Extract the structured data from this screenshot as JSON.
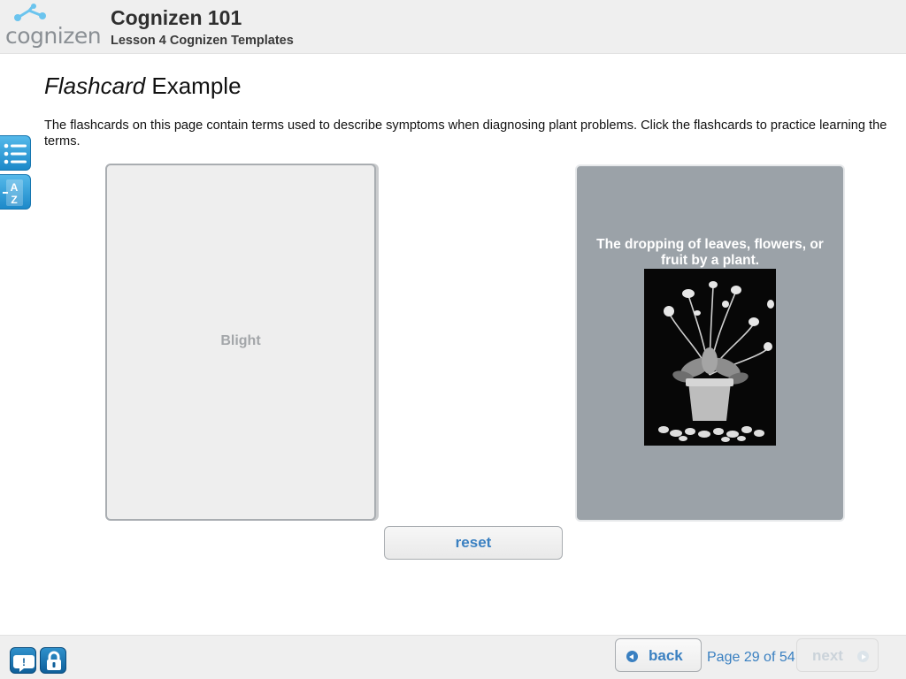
{
  "header": {
    "logo_text": "cognizen",
    "course_title": "Cognizen 101",
    "lesson_title": "Lesson 4 Cognizen Templates"
  },
  "page": {
    "title_italic": "Flashcard",
    "title_rest": " Example",
    "instructions": "The flashcards on this page contain terms used to describe symptoms when diagnosing plant problems. Click the flashcards to practice learning the terms."
  },
  "side_tools": [
    {
      "icon": "list-icon"
    },
    {
      "icon": "a-z-glossary-icon"
    }
  ],
  "flashcards": [
    {
      "side": "front",
      "term": "Blight"
    },
    {
      "side": "back",
      "definition": "The dropping of leaves, flowers, or fruit by a plant.",
      "image": "potted-plant-photo"
    }
  ],
  "reset_label": "reset",
  "footer": {
    "help_icon": "help-icon",
    "lock_icon": "lock-icon",
    "back_label": "back",
    "page_indicator": "Page 29 of 54",
    "next_label": "next"
  },
  "colors": {
    "accent": "#3a80c1",
    "side_button": "#2a9ad8",
    "card_back": "#9ba2a8"
  }
}
